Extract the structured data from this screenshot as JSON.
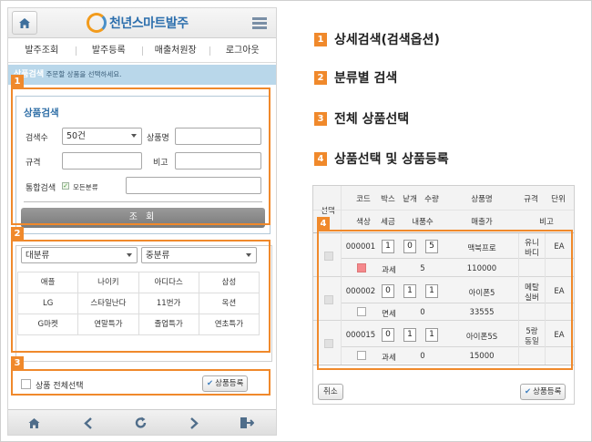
{
  "app": {
    "title": "천년스마트발주"
  },
  "nav": [
    "발주조회",
    "발주등록",
    "매출처원장",
    "로그아웃"
  ],
  "info_bar": {
    "title": "상품검색",
    "text": "주문할 상품을 선택하세요."
  },
  "search": {
    "title": "상품검색",
    "count_label": "검색수",
    "count_value": "50건",
    "product_name_label": "상품명",
    "spec_label": "규격",
    "note_label": "비고",
    "combined_label": "통합검색",
    "all_categories_label": "모든분류",
    "query_button": "조 회"
  },
  "category": {
    "major": "대분류",
    "middle": "중분류",
    "items": [
      "애플",
      "나이키",
      "아디다스",
      "삼성",
      "LG",
      "스타일난다",
      "11번가",
      "옥션",
      "G마켓",
      "연말특가",
      "졸업특가",
      "연초특가"
    ]
  },
  "select_bar": {
    "select_all_label": "상품 전체선택",
    "register_button": "상품등록"
  },
  "legend": [
    {
      "num": "1",
      "text": "상세검색(검색옵션)"
    },
    {
      "num": "2",
      "text": "분류별 검색"
    },
    {
      "num": "3",
      "text": "전체 상품선택"
    },
    {
      "num": "4",
      "text": "상품선택 및 상품등록"
    }
  ],
  "badges": [
    "1",
    "2",
    "3",
    "4"
  ],
  "table": {
    "header_select": "선택",
    "header_row1": [
      "코드",
      "박스",
      "낱개",
      "수량",
      "상품명",
      "규격",
      "단위"
    ],
    "header_row2": [
      "색상",
      "세금",
      "내품수",
      "매출가",
      "비고"
    ],
    "rows": [
      {
        "code": "000001",
        "box": "1",
        "piece": "0",
        "qty": "5",
        "name": "맥북프로",
        "spec_line1": "유니",
        "spec_line2": "바디",
        "unit": "EA",
        "tax": "과세",
        "inner": "5",
        "price": "110000",
        "color": "pink"
      },
      {
        "code": "000002",
        "box": "0",
        "piece": "1",
        "qty": "1",
        "name": "아이폰5",
        "spec_line1": "메탈",
        "spec_line2": "실버",
        "unit": "EA",
        "tax": "면세",
        "inner": "0",
        "price": "33555",
        "color": "white"
      },
      {
        "code": "000015",
        "box": "0",
        "piece": "1",
        "qty": "1",
        "name": "아이폰5S",
        "spec_line1": "5랑",
        "spec_line2": "동일",
        "unit": "EA",
        "tax": "과세",
        "inner": "0",
        "price": "15000",
        "color": "white"
      }
    ],
    "cancel_button": "취소",
    "register_button": "상품등록"
  },
  "colors": {
    "accent_orange": "#f0892b",
    "brand_blue": "#2d6fad",
    "info_bar": "#b9d7ea"
  }
}
